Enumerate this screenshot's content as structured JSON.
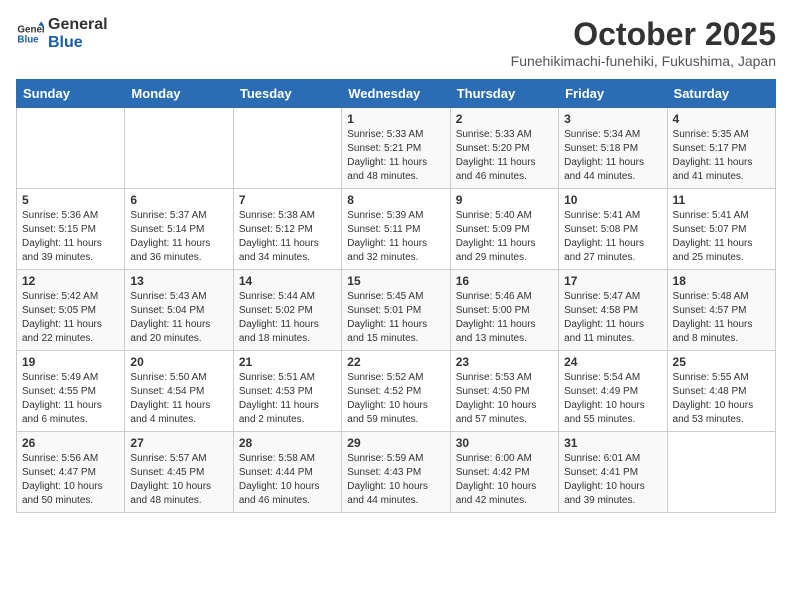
{
  "logo": {
    "general": "General",
    "blue": "Blue"
  },
  "header": {
    "month": "October 2025",
    "location": "Funehikimachi-funehiki, Fukushima, Japan"
  },
  "weekdays": [
    "Sunday",
    "Monday",
    "Tuesday",
    "Wednesday",
    "Thursday",
    "Friday",
    "Saturday"
  ],
  "weeks": [
    [
      {
        "day": "",
        "info": ""
      },
      {
        "day": "",
        "info": ""
      },
      {
        "day": "",
        "info": ""
      },
      {
        "day": "1",
        "info": "Sunrise: 5:33 AM\nSunset: 5:21 PM\nDaylight: 11 hours\nand 48 minutes."
      },
      {
        "day": "2",
        "info": "Sunrise: 5:33 AM\nSunset: 5:20 PM\nDaylight: 11 hours\nand 46 minutes."
      },
      {
        "day": "3",
        "info": "Sunrise: 5:34 AM\nSunset: 5:18 PM\nDaylight: 11 hours\nand 44 minutes."
      },
      {
        "day": "4",
        "info": "Sunrise: 5:35 AM\nSunset: 5:17 PM\nDaylight: 11 hours\nand 41 minutes."
      }
    ],
    [
      {
        "day": "5",
        "info": "Sunrise: 5:36 AM\nSunset: 5:15 PM\nDaylight: 11 hours\nand 39 minutes."
      },
      {
        "day": "6",
        "info": "Sunrise: 5:37 AM\nSunset: 5:14 PM\nDaylight: 11 hours\nand 36 minutes."
      },
      {
        "day": "7",
        "info": "Sunrise: 5:38 AM\nSunset: 5:12 PM\nDaylight: 11 hours\nand 34 minutes."
      },
      {
        "day": "8",
        "info": "Sunrise: 5:39 AM\nSunset: 5:11 PM\nDaylight: 11 hours\nand 32 minutes."
      },
      {
        "day": "9",
        "info": "Sunrise: 5:40 AM\nSunset: 5:09 PM\nDaylight: 11 hours\nand 29 minutes."
      },
      {
        "day": "10",
        "info": "Sunrise: 5:41 AM\nSunset: 5:08 PM\nDaylight: 11 hours\nand 27 minutes."
      },
      {
        "day": "11",
        "info": "Sunrise: 5:41 AM\nSunset: 5:07 PM\nDaylight: 11 hours\nand 25 minutes."
      }
    ],
    [
      {
        "day": "12",
        "info": "Sunrise: 5:42 AM\nSunset: 5:05 PM\nDaylight: 11 hours\nand 22 minutes."
      },
      {
        "day": "13",
        "info": "Sunrise: 5:43 AM\nSunset: 5:04 PM\nDaylight: 11 hours\nand 20 minutes."
      },
      {
        "day": "14",
        "info": "Sunrise: 5:44 AM\nSunset: 5:02 PM\nDaylight: 11 hours\nand 18 minutes."
      },
      {
        "day": "15",
        "info": "Sunrise: 5:45 AM\nSunset: 5:01 PM\nDaylight: 11 hours\nand 15 minutes."
      },
      {
        "day": "16",
        "info": "Sunrise: 5:46 AM\nSunset: 5:00 PM\nDaylight: 11 hours\nand 13 minutes."
      },
      {
        "day": "17",
        "info": "Sunrise: 5:47 AM\nSunset: 4:58 PM\nDaylight: 11 hours\nand 11 minutes."
      },
      {
        "day": "18",
        "info": "Sunrise: 5:48 AM\nSunset: 4:57 PM\nDaylight: 11 hours\nand 8 minutes."
      }
    ],
    [
      {
        "day": "19",
        "info": "Sunrise: 5:49 AM\nSunset: 4:55 PM\nDaylight: 11 hours\nand 6 minutes."
      },
      {
        "day": "20",
        "info": "Sunrise: 5:50 AM\nSunset: 4:54 PM\nDaylight: 11 hours\nand 4 minutes."
      },
      {
        "day": "21",
        "info": "Sunrise: 5:51 AM\nSunset: 4:53 PM\nDaylight: 11 hours\nand 2 minutes."
      },
      {
        "day": "22",
        "info": "Sunrise: 5:52 AM\nSunset: 4:52 PM\nDaylight: 10 hours\nand 59 minutes."
      },
      {
        "day": "23",
        "info": "Sunrise: 5:53 AM\nSunset: 4:50 PM\nDaylight: 10 hours\nand 57 minutes."
      },
      {
        "day": "24",
        "info": "Sunrise: 5:54 AM\nSunset: 4:49 PM\nDaylight: 10 hours\nand 55 minutes."
      },
      {
        "day": "25",
        "info": "Sunrise: 5:55 AM\nSunset: 4:48 PM\nDaylight: 10 hours\nand 53 minutes."
      }
    ],
    [
      {
        "day": "26",
        "info": "Sunrise: 5:56 AM\nSunset: 4:47 PM\nDaylight: 10 hours\nand 50 minutes."
      },
      {
        "day": "27",
        "info": "Sunrise: 5:57 AM\nSunset: 4:45 PM\nDaylight: 10 hours\nand 48 minutes."
      },
      {
        "day": "28",
        "info": "Sunrise: 5:58 AM\nSunset: 4:44 PM\nDaylight: 10 hours\nand 46 minutes."
      },
      {
        "day": "29",
        "info": "Sunrise: 5:59 AM\nSunset: 4:43 PM\nDaylight: 10 hours\nand 44 minutes."
      },
      {
        "day": "30",
        "info": "Sunrise: 6:00 AM\nSunset: 4:42 PM\nDaylight: 10 hours\nand 42 minutes."
      },
      {
        "day": "31",
        "info": "Sunrise: 6:01 AM\nSunset: 4:41 PM\nDaylight: 10 hours\nand 39 minutes."
      },
      {
        "day": "",
        "info": ""
      }
    ]
  ]
}
